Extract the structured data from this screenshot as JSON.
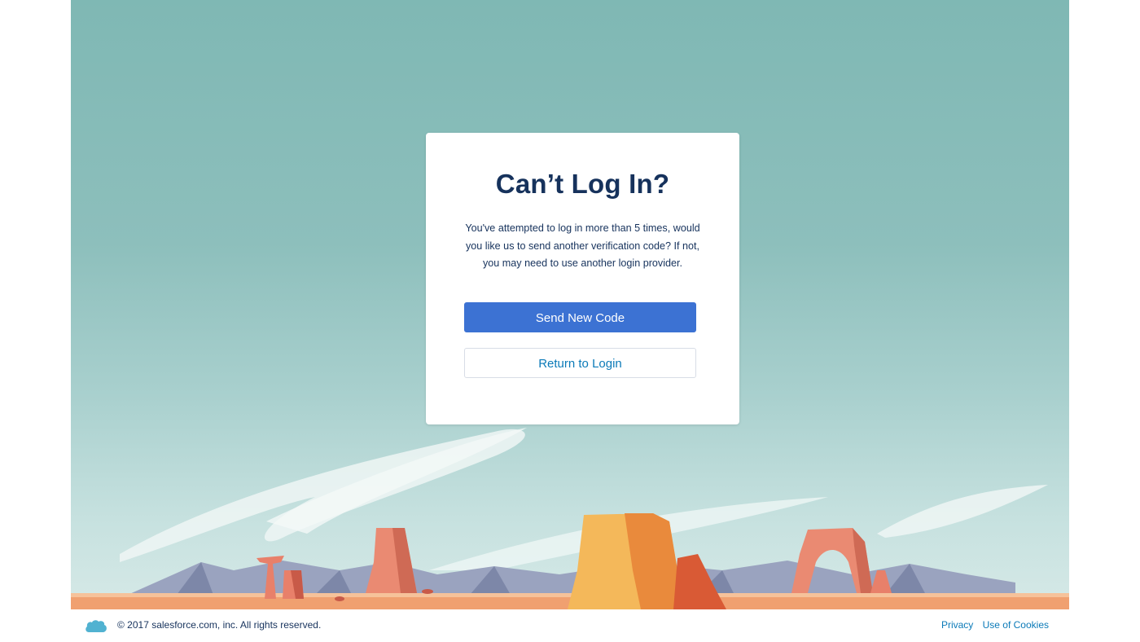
{
  "card": {
    "title": "Can’t Log In?",
    "message": "You've attempted to log in more than 5 times, would you like us to send another verification code? If not, you may need to use another login provider.",
    "primary_button": "Send New Code",
    "secondary_button": "Return to Login"
  },
  "footer": {
    "copyright": "© 2017 salesforce.com, inc. All rights reserved.",
    "privacy_link": "Privacy",
    "cookies_link": "Use of Cookies",
    "logo_icon": "salesforce-cloud-icon"
  },
  "colors": {
    "title": "#16325c",
    "primary_button": "#3c72d3",
    "link": "#0b7ab8",
    "sky_top": "#7fb8b4",
    "ground": "#f0a070"
  }
}
